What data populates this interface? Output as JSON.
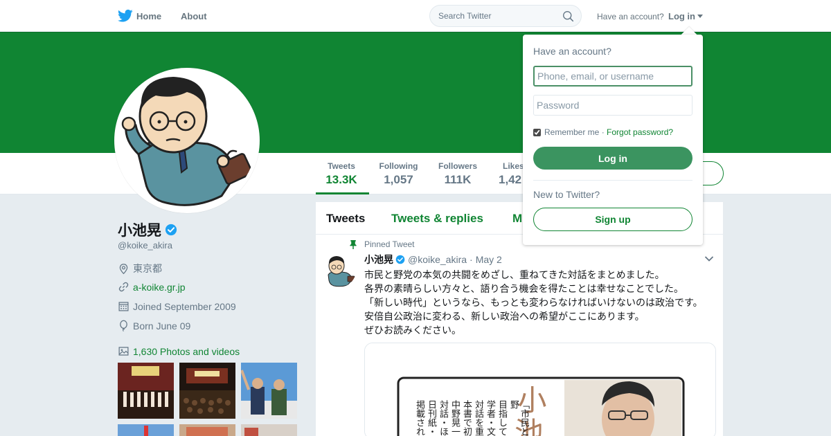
{
  "nav": {
    "home_label": "Home",
    "about_label": "About",
    "search_placeholder": "Search Twitter",
    "have_account": "Have an account?",
    "login_label": "Log in"
  },
  "profile": {
    "name": "小池晃",
    "handle": "@koike_akira",
    "location": "東京都",
    "website": "a-koike.gr.jp",
    "joined": "Joined September 2009",
    "born": "Born June 09",
    "photos_label": "1,630 Photos and videos"
  },
  "stats": [
    {
      "label": "Tweets",
      "value": "13.3K"
    },
    {
      "label": "Following",
      "value": "1,057"
    },
    {
      "label": "Followers",
      "value": "111K"
    },
    {
      "label": "Likes",
      "value": "1,42"
    }
  ],
  "timeline": {
    "tabs": [
      "Tweets",
      "Tweets & replies",
      "M"
    ]
  },
  "tweet": {
    "pinned_label": "Pinned Tweet",
    "name": "小池晃",
    "handle": "@koike_akira",
    "dot": "·",
    "date": "May 2",
    "lines": [
      "市民と野党の本気の共闘をめざし、重ねてきた対話をまとめました。",
      "各界の素晴らしい方々と、語り合う機会を得たことは幸せなことでした。",
      "「新しい時代」というなら、もっとも変わらなければいけないのは政治です。",
      "安倍自公政治に変わる、新しい政治への希望がここにあります。",
      "ぜひお読みください。"
    ],
    "card_big_char": "小",
    "card_big_char2": "池",
    "card_cols": [
      "「市民と野",
      "目指して",
      "学者・文",
      "対話を重",
      "本書で初",
      "中野晃一",
      "対話・ほ",
      "日刊紙・",
      "掲載され"
    ]
  },
  "login_dropdown": {
    "title": "Have an account?",
    "username_placeholder": "Phone, email, or username",
    "password_placeholder": "Password",
    "remember_label": "Remember me",
    "separator": " · ",
    "forgot_label": "Forgot password?",
    "login_button": "Log in",
    "new_label": "New to Twitter?",
    "signup_button": "Sign up"
  },
  "colors": {
    "brand": "#108533",
    "twitter_blue": "#1da1f2",
    "verified": "#1da1f2"
  }
}
